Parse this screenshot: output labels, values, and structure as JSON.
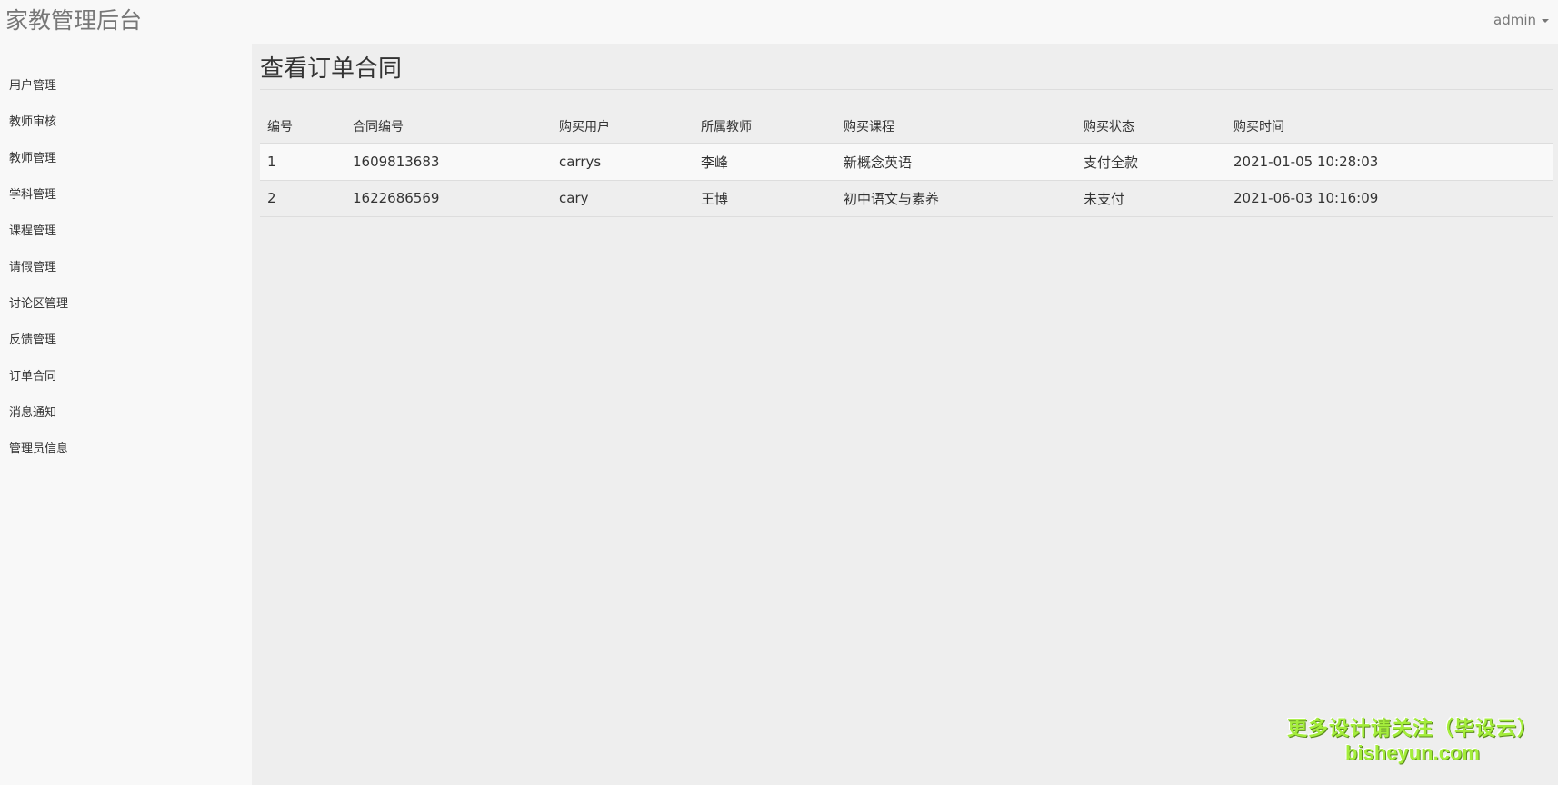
{
  "header": {
    "brand": "家教管理后台",
    "user": "admin"
  },
  "sidebar": {
    "items": [
      {
        "label": "用户管理"
      },
      {
        "label": "教师审核"
      },
      {
        "label": "教师管理"
      },
      {
        "label": "学科管理"
      },
      {
        "label": "课程管理"
      },
      {
        "label": "请假管理"
      },
      {
        "label": "讨论区管理"
      },
      {
        "label": "反馈管理"
      },
      {
        "label": "订单合同"
      },
      {
        "label": "消息通知"
      },
      {
        "label": "管理员信息"
      }
    ]
  },
  "main": {
    "title": "查看订单合同",
    "table": {
      "columns": [
        "编号",
        "合同编号",
        "购买用户",
        "所属教师",
        "购买课程",
        "购买状态",
        "购买时间"
      ],
      "rows": [
        [
          "1",
          "1609813683",
          "carrys",
          "李峰",
          "新概念英语",
          "支付全款",
          "2021-01-05 10:28:03"
        ],
        [
          "2",
          "1622686569",
          "cary",
          "王博",
          "初中语文与素养",
          "未支付",
          "2021-06-03 10:16:09"
        ]
      ]
    }
  },
  "watermark": {
    "line1": "更多设计请关注（毕设云）",
    "line2": "bisheyun.com",
    "color": "#a4ed3b"
  }
}
